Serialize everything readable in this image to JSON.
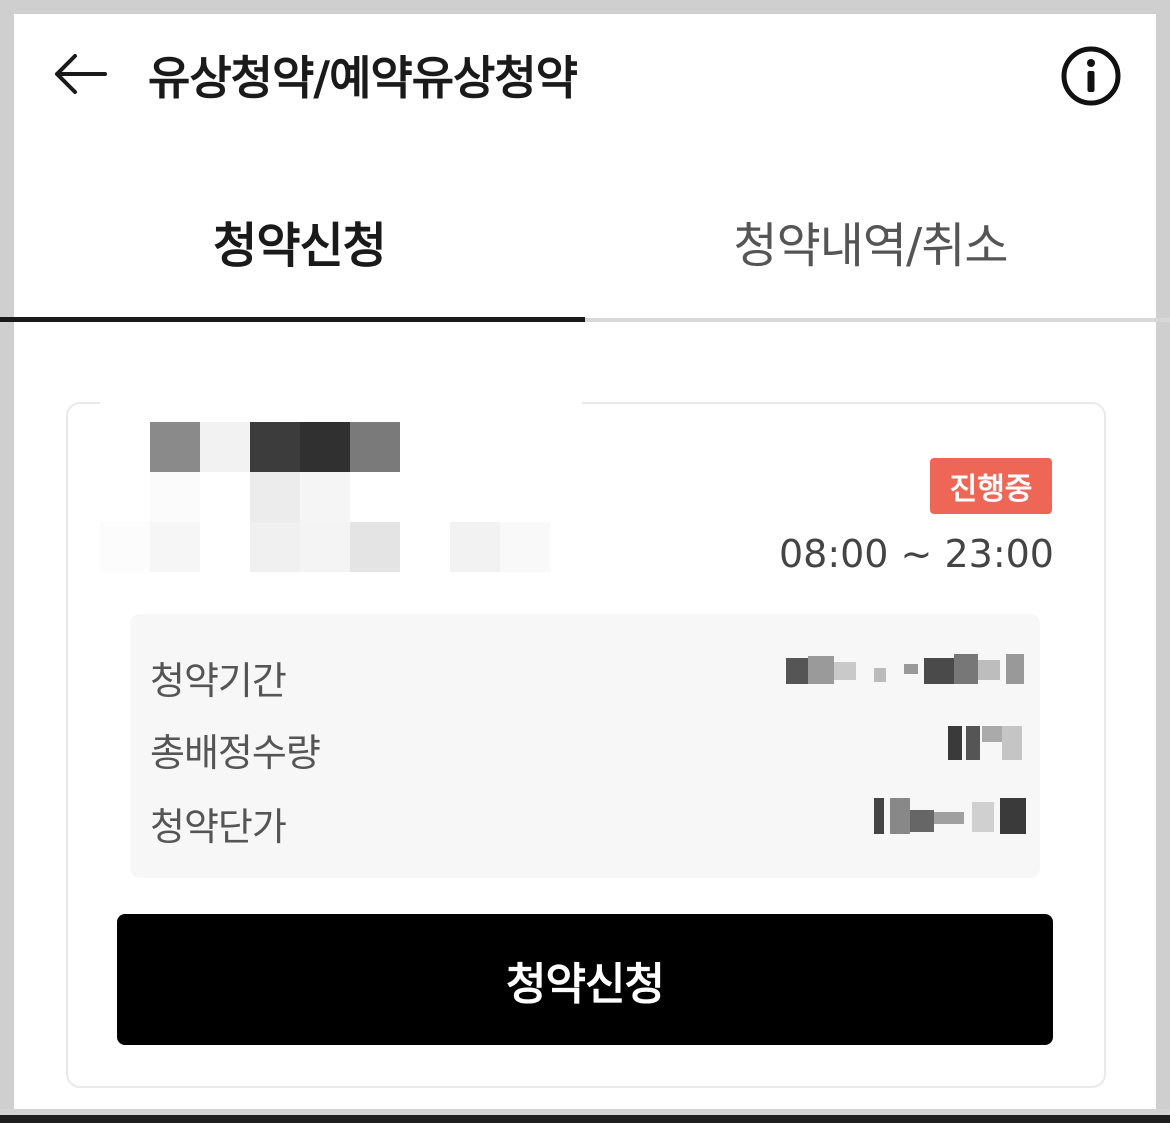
{
  "header": {
    "title": "유상청약/예약유상청약",
    "back_icon": "arrow-left-icon",
    "info_icon": "info-circle-icon"
  },
  "tabs": [
    {
      "label": "청약신청",
      "active": true
    },
    {
      "label": "청약내역/취소",
      "active": false
    }
  ],
  "offering": {
    "status_badge": "진행중",
    "status_color": "#ee6655",
    "time_range": "08:00 ~ 23:00",
    "details": [
      {
        "label": "청약기간"
      },
      {
        "label": "총배정수량"
      },
      {
        "label": "청약단가"
      }
    ],
    "apply_button_label": "청약신청"
  }
}
